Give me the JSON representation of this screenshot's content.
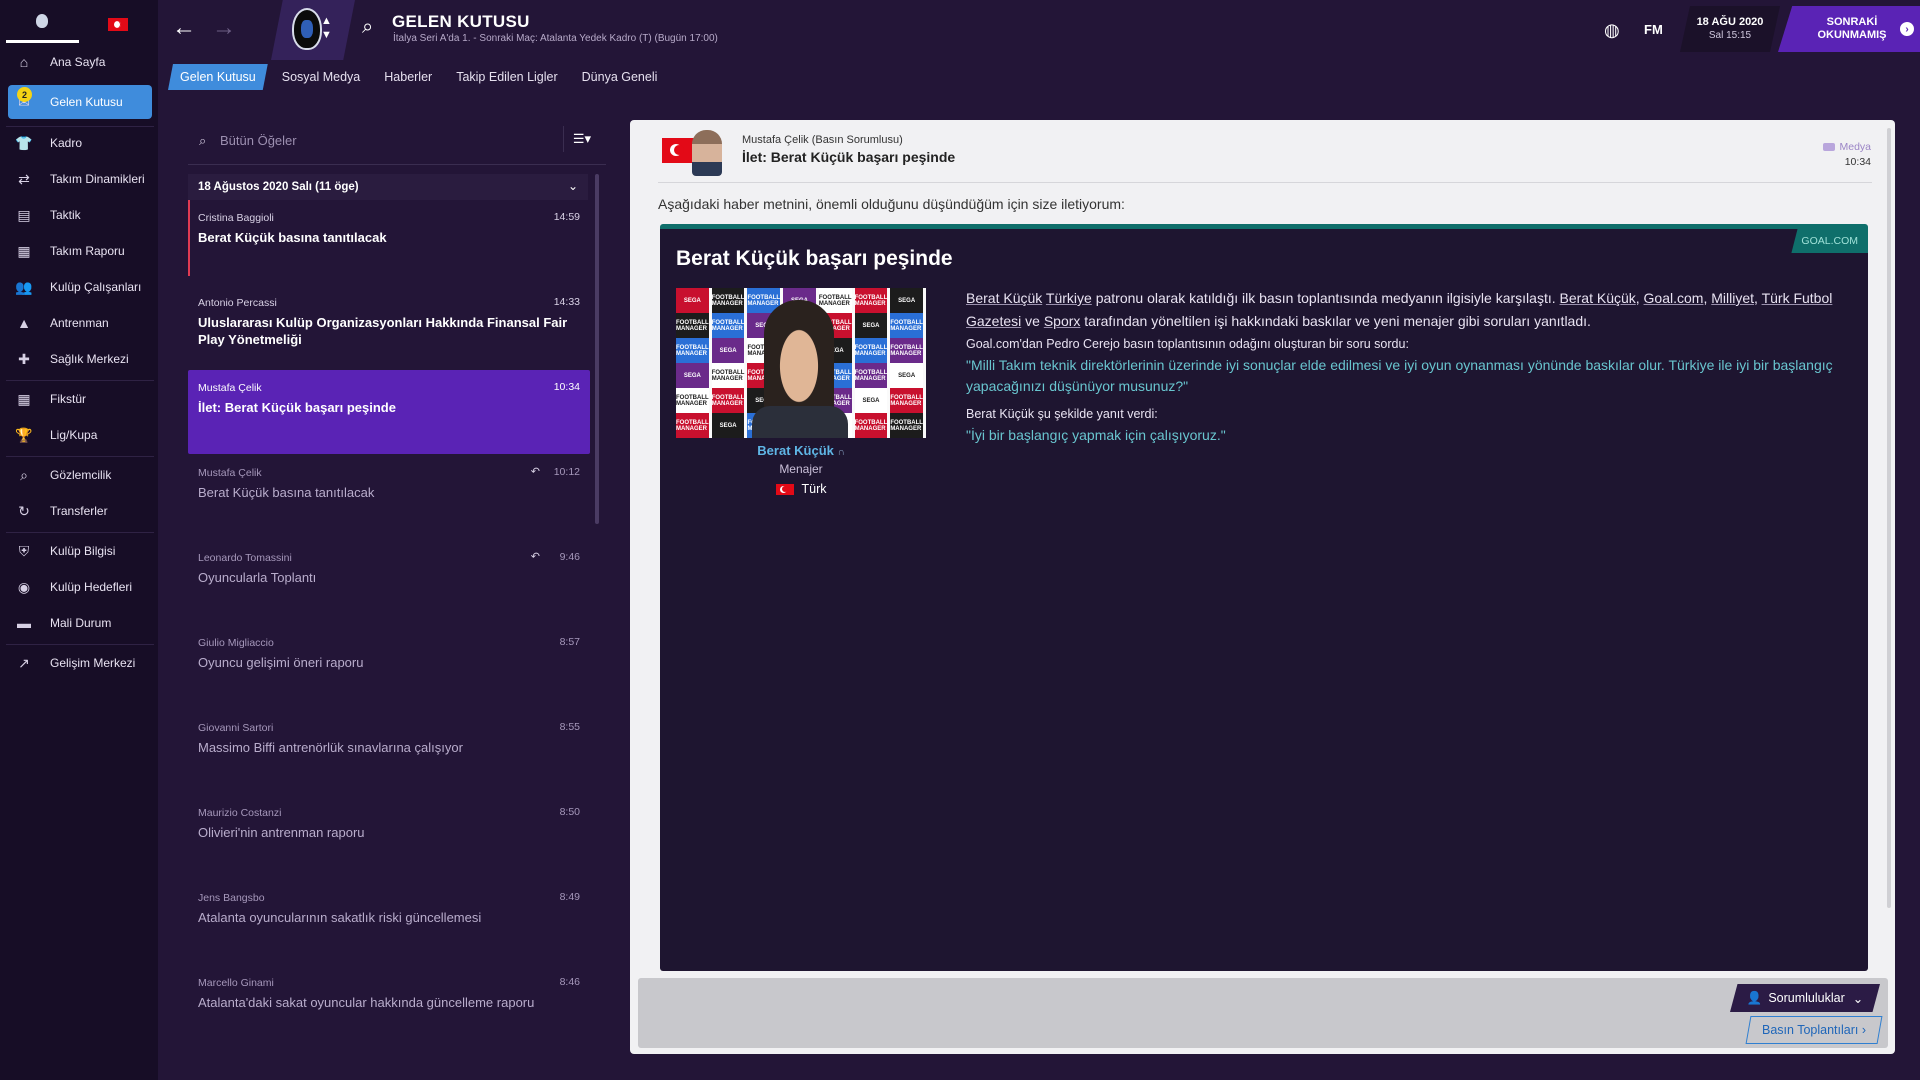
{
  "colors": {
    "accent": "#3f8cdc",
    "brand_purple": "#5a23b5",
    "teal": "#0f6f6b",
    "badge": "#f5d415"
  },
  "sidebar": {
    "badge": "2",
    "items": [
      {
        "label": "Ana Sayfa",
        "icon": "home-icon"
      },
      {
        "label": "Gelen Kutusu",
        "icon": "inbox-icon"
      },
      {
        "label": "Kadro",
        "icon": "shirt-icon"
      },
      {
        "label": "Takım Dinamikleri",
        "icon": "dynamics-icon"
      },
      {
        "label": "Taktik",
        "icon": "tactics-icon"
      },
      {
        "label": "Takım Raporu",
        "icon": "report-icon"
      },
      {
        "label": "Kulüp Çalışanları",
        "icon": "staff-icon"
      },
      {
        "label": "Antrenman",
        "icon": "training-icon"
      },
      {
        "label": "Sağlık Merkezi",
        "icon": "medical-icon"
      },
      {
        "label": "Fikstür",
        "icon": "calendar-icon"
      },
      {
        "label": "Lig/Kupa",
        "icon": "trophy-icon"
      },
      {
        "label": "Gözlemcilik",
        "icon": "scouting-icon"
      },
      {
        "label": "Transferler",
        "icon": "transfers-icon"
      },
      {
        "label": "Kulüp Bilgisi",
        "icon": "shield-icon"
      },
      {
        "label": "Kulüp Hedefleri",
        "icon": "goals-icon"
      },
      {
        "label": "Mali Durum",
        "icon": "finance-icon"
      },
      {
        "label": "Gelişim Merkezi",
        "icon": "development-icon"
      }
    ]
  },
  "header": {
    "title": "GELEN KUTUSU",
    "subtitle": "İtalya Seri A'da 1. - Sonraki Maç: Atalanta Yedek Kadro (T) (Bugün 17:00)",
    "fm": "FM",
    "date": "18 AĞU 2020",
    "time": "Sal 15:15",
    "next_label": "SONRAKİ OKUNMAMIŞ"
  },
  "tabs": [
    "Gelen Kutusu",
    "Sosyal Medya",
    "Haberler",
    "Takip Edilen Ligler",
    "Dünya Geneli"
  ],
  "inbox": {
    "search_placeholder": "Bütün Öğeler",
    "group_label": "18 Ağustos 2020 Salı (11 öge)",
    "messages": [
      {
        "sender": "Cristina Baggioli",
        "time": "14:59",
        "subject": "Berat Küçük basına tanıtılacak"
      },
      {
        "sender": "Antonio Percassi",
        "time": "14:33",
        "subject": "Uluslararası Kulüp Organizasyonları Hakkında Finansal Fair Play Yönetmeliği"
      },
      {
        "sender": "Mustafa Çelik",
        "time": "10:34",
        "subject": "İlet: Berat Küçük başarı peşinde"
      },
      {
        "sender": "Mustafa Çelik",
        "time": "10:12",
        "subject": "Berat Küçük basına tanıtılacak"
      },
      {
        "sender": "Leonardo Tomassini",
        "time": "9:46",
        "subject": "Oyuncularla Toplantı"
      },
      {
        "sender": "Giulio Migliaccio",
        "time": "8:57",
        "subject": "Oyuncu gelişimi öneri raporu"
      },
      {
        "sender": "Giovanni Sartori",
        "time": "8:55",
        "subject": "Massimo Biffi antrenörlük sınavlarına çalışıyor"
      },
      {
        "sender": "Maurizio Costanzi",
        "time": "8:50",
        "subject": "Olivieri'nin antrenman raporu"
      },
      {
        "sender": "Jens Bangsbo",
        "time": "8:49",
        "subject": "Atalanta oyuncularının sakatlık riski güncellemesi"
      },
      {
        "sender": "Marcello Ginami",
        "time": "8:46",
        "subject": "Atalanta'daki sakat oyuncular hakkında güncelleme raporu"
      }
    ]
  },
  "message": {
    "sender": "Mustafa Çelik  (Basın Sorumlusu)",
    "subject": "İlet: Berat Küçük başarı peşinde",
    "type": "Medya",
    "time": "10:34",
    "intro": "Aşağıdaki haber metnini, önemli olduğunu düşündüğüm için size iletiyorum:",
    "article": {
      "source": "GOAL.COM",
      "title": "Berat Küçük başarı peşinde",
      "sponsor_text": "FOOTBALL MANAGER",
      "sponsor_text_2": "SEGA",
      "person_name": "Berat Küçük",
      "person_role": "Menajer",
      "person_nationality": "Türk",
      "p1_a": "Berat Küçük",
      "p1_b": "Türkiye",
      "p1_c": " patronu olarak katıldığı ilk basın toplantısında medyanın ilgisiyle karşılaştı. ",
      "p1_d": "Berat Küçük",
      "p1_e": ", ",
      "p1_f": "Goal.com",
      "p1_g": ", ",
      "p1_h": "Milliyet",
      "p1_i": ", ",
      "p1_j": "Türk Futbol Gazetesi",
      "p1_k": " ve ",
      "p1_l": "Sporx",
      "p1_m": " tarafından yöneltilen işi hakkındaki baskılar ve yeni menajer gibi soruları yanıtladı.",
      "p2": "Goal.com'dan Pedro Cerejo basın toplantısının odağını oluşturan bir soru sordu:",
      "quote1": "\"Milli Takım teknik direktörlerinin üzerinde iyi sonuçlar elde edilmesi ve iyi oyun oynanması yönünde baskılar olur. Türkiye ile iyi bir başlangıç yapacağınızı düşünüyor musunuz?\"",
      "p3": "Berat Küçük şu şekilde yanıt verdi:",
      "quote2": "\"İyi bir başlangıç yapmak için çalışıyoruz.\""
    },
    "buttons": {
      "responsibilities": "Sorumluluklar",
      "press": "Basın Toplantıları"
    }
  }
}
